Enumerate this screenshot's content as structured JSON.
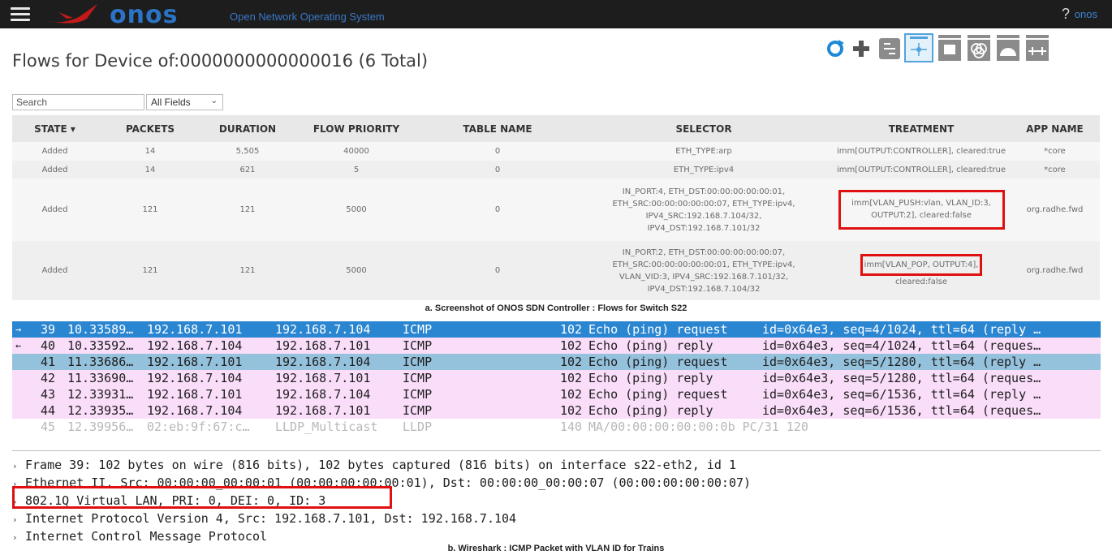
{
  "header": {
    "logo_text": "onos",
    "logo_subtitle": "Open Network Operating System",
    "help_label": "?",
    "user_label": "onos"
  },
  "page": {
    "title": "Flows for Device of:0000000000000016 (6 Total)"
  },
  "controls": {
    "search_placeholder": "Search",
    "field_select_value": "All Fields",
    "toolbar_icons": [
      "refresh-icon",
      "add-flow-icon",
      "switch-icon",
      "device-summary-icon",
      "ports-icon",
      "groups-icon",
      "meters-icon",
      "pipeconf-icon"
    ]
  },
  "flows": {
    "columns": [
      "STATE ▾",
      "PACKETS",
      "DURATION",
      "FLOW PRIORITY",
      "TABLE NAME",
      "SELECTOR",
      "TREATMENT",
      "APP NAME"
    ],
    "rows": [
      {
        "state": "Added",
        "packets": "14",
        "duration": "5,505",
        "priority": "40000",
        "table": "0",
        "selector": [
          "ETH_TYPE:arp"
        ],
        "treatment": [
          "imm[OUTPUT:CONTROLLER], cleared:true"
        ],
        "app": "*core"
      },
      {
        "state": "Added",
        "packets": "14",
        "duration": "621",
        "priority": "5",
        "table": "0",
        "selector": [
          "ETH_TYPE:ipv4"
        ],
        "treatment": [
          "imm[OUTPUT:CONTROLLER], cleared:true"
        ],
        "app": "*core"
      },
      {
        "state": "Added",
        "packets": "121",
        "duration": "121",
        "priority": "5000",
        "table": "0",
        "selector": [
          "IN_PORT:4, ETH_DST:00:00:00:00:00:01,",
          "ETH_SRC:00:00:00:00:00:07, ETH_TYPE:ipv4,",
          "IPV4_SRC:192.168.7.104/32,",
          "IPV4_DST:192.168.7.101/32"
        ],
        "treatment": [
          "imm[VLAN_PUSH:vlan, VLAN_ID:3,",
          "OUTPUT:2], cleared:false"
        ],
        "app": "org.radhe.fwd"
      },
      {
        "state": "Added",
        "packets": "121",
        "duration": "121",
        "priority": "5000",
        "table": "0",
        "selector": [
          "IN_PORT:2, ETH_DST:00:00:00:00:00:07,",
          "ETH_SRC:00:00:00:00:00:01, ETH_TYPE:ipv4,",
          "VLAN_VID:3, IPV4_SRC:192.168.7.101/32,",
          "IPV4_DST:192.168.7.104/32"
        ],
        "treatment_highlighted": "imm[VLAN_POP, OUTPUT:4],",
        "treatment_rest": " cleared:false",
        "app": "org.radhe.fwd"
      }
    ]
  },
  "captions": {
    "a": "a. Screenshot of ONOS SDN Controller : Flows for Switch S22",
    "b": "b. Wireshark : ICMP Packet with VLAN ID for Trains"
  },
  "packets": [
    {
      "no": "39",
      "time": "10.33589…",
      "src": "192.168.7.101",
      "dst": "192.168.7.104",
      "proto": "ICMP",
      "len": "102",
      "info": "Echo (ping) request",
      "extra": "id=0x64e3, seq=4/1024, ttl=64 (reply …",
      "style": "selected",
      "mark": "→"
    },
    {
      "no": "40",
      "time": "10.33592…",
      "src": "192.168.7.104",
      "dst": "192.168.7.101",
      "proto": "ICMP",
      "len": "102",
      "info": "Echo (ping) reply",
      "extra": "id=0x64e3, seq=4/1024, ttl=64 (reques…",
      "style": "icmp",
      "mark": "←"
    },
    {
      "no": "41",
      "time": "11.33686…",
      "src": "192.168.7.101",
      "dst": "192.168.7.104",
      "proto": "ICMP",
      "len": "102",
      "info": "Echo (ping) request",
      "extra": "id=0x64e3, seq=5/1280, ttl=64 (reply …",
      "style": "related",
      "mark": ""
    },
    {
      "no": "42",
      "time": "11.33690…",
      "src": "192.168.7.104",
      "dst": "192.168.7.101",
      "proto": "ICMP",
      "len": "102",
      "info": "Echo (ping) reply",
      "extra": "id=0x64e3, seq=5/1280, ttl=64 (reques…",
      "style": "icmp",
      "mark": ""
    },
    {
      "no": "43",
      "time": "12.33931…",
      "src": "192.168.7.101",
      "dst": "192.168.7.104",
      "proto": "ICMP",
      "len": "102",
      "info": "Echo (ping) request",
      "extra": "id=0x64e3, seq=6/1536, ttl=64 (reply …",
      "style": "icmp",
      "mark": ""
    },
    {
      "no": "44",
      "time": "12.33935…",
      "src": "192.168.7.104",
      "dst": "192.168.7.101",
      "proto": "ICMP",
      "len": "102",
      "info": "Echo (ping) reply",
      "extra": "id=0x64e3, seq=6/1536, ttl=64 (reques…",
      "style": "icmp",
      "mark": ""
    },
    {
      "no": "45",
      "time": "12.39956…",
      "src": "02:eb:9f:67:c…",
      "dst": "LLDP_Multicast",
      "proto": "LLDP",
      "len": "140",
      "info": "MA/00:00:00:00:00:0b PC/31 120",
      "extra": "",
      "style": "lldp",
      "mark": ""
    }
  ],
  "details": [
    "Frame 39: 102 bytes on wire (816 bits), 102 bytes captured (816 bits) on interface s22-eth2, id 1",
    "Ethernet II, Src: 00:00:00_00:00:01 (00:00:00:00:00:01), Dst: 00:00:00_00:00:07 (00:00:00:00:00:07)",
    "802.1Q Virtual LAN, PRI: 0, DEI: 0, ID: 3",
    "Internet Protocol Version 4, Src: 192.168.7.101, Dst: 192.168.7.104",
    "Internet Control Message Protocol"
  ],
  "colors": {
    "highlight_red": "#e01010",
    "selected_row": "#2a86d1",
    "icmp_row": "#f9ddf9",
    "related_row": "#94c1dc",
    "onos_blue": "#2b73c4"
  }
}
